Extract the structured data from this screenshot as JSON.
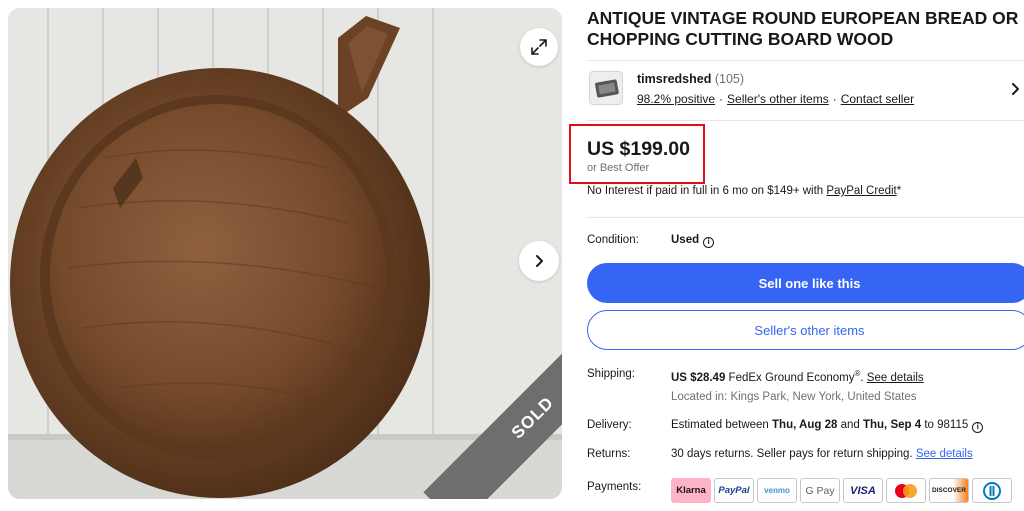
{
  "listing": {
    "title": "ANTIQUE VINTAGE ROUND EUROPEAN BREAD OR CHOPPING CUTTING BOARD WOOD",
    "sold_label": "SOLD"
  },
  "seller": {
    "name": "timsredshed",
    "feedback_count": "(105)",
    "positive": "98.2% positive",
    "other_items_link": "Seller's other items",
    "contact_link": "Contact seller"
  },
  "price": {
    "amount": "US $199.00",
    "best_offer": "or Best Offer",
    "financing_prefix": "No Interest if paid in full in 6 mo on $149+ with ",
    "financing_link": "PayPal Credit",
    "financing_suffix": "*"
  },
  "condition": {
    "label": "Condition:",
    "value": "Used"
  },
  "buttons": {
    "sell_one": "Sell one like this",
    "seller_items": "Seller's other items"
  },
  "shipping": {
    "label": "Shipping:",
    "price": "US $28.49",
    "service": " FedEx Ground Economy",
    "service_mark": "®",
    "period": ". ",
    "details_link": "See details",
    "location": "Located in: Kings Park, New York, United States"
  },
  "delivery": {
    "label": "Delivery:",
    "prefix": "Estimated between ",
    "date_start": "Thu, Aug 28",
    "and": " and ",
    "date_end": "Thu, Sep 4",
    "suffix": " to 98115"
  },
  "returns": {
    "label": "Returns:",
    "text": "30 days returns. Seller pays for return shipping. ",
    "details_link": "See details"
  },
  "payments": {
    "label": "Payments:",
    "methods": [
      "Klarna",
      "PayPal",
      "venmo",
      "G Pay",
      "VISA",
      "Mastercard",
      "DISCOVER",
      "Diners Club"
    ]
  },
  "colors": {
    "accent_blue": "#3665f3",
    "highlight_red": "#e0101a",
    "sold_gray": "#6e6e6e",
    "klarna_pink": "#ffb3c7"
  },
  "icons": [
    "expand-icon",
    "chevron-right-icon",
    "seller-avatar",
    "info-icon"
  ]
}
